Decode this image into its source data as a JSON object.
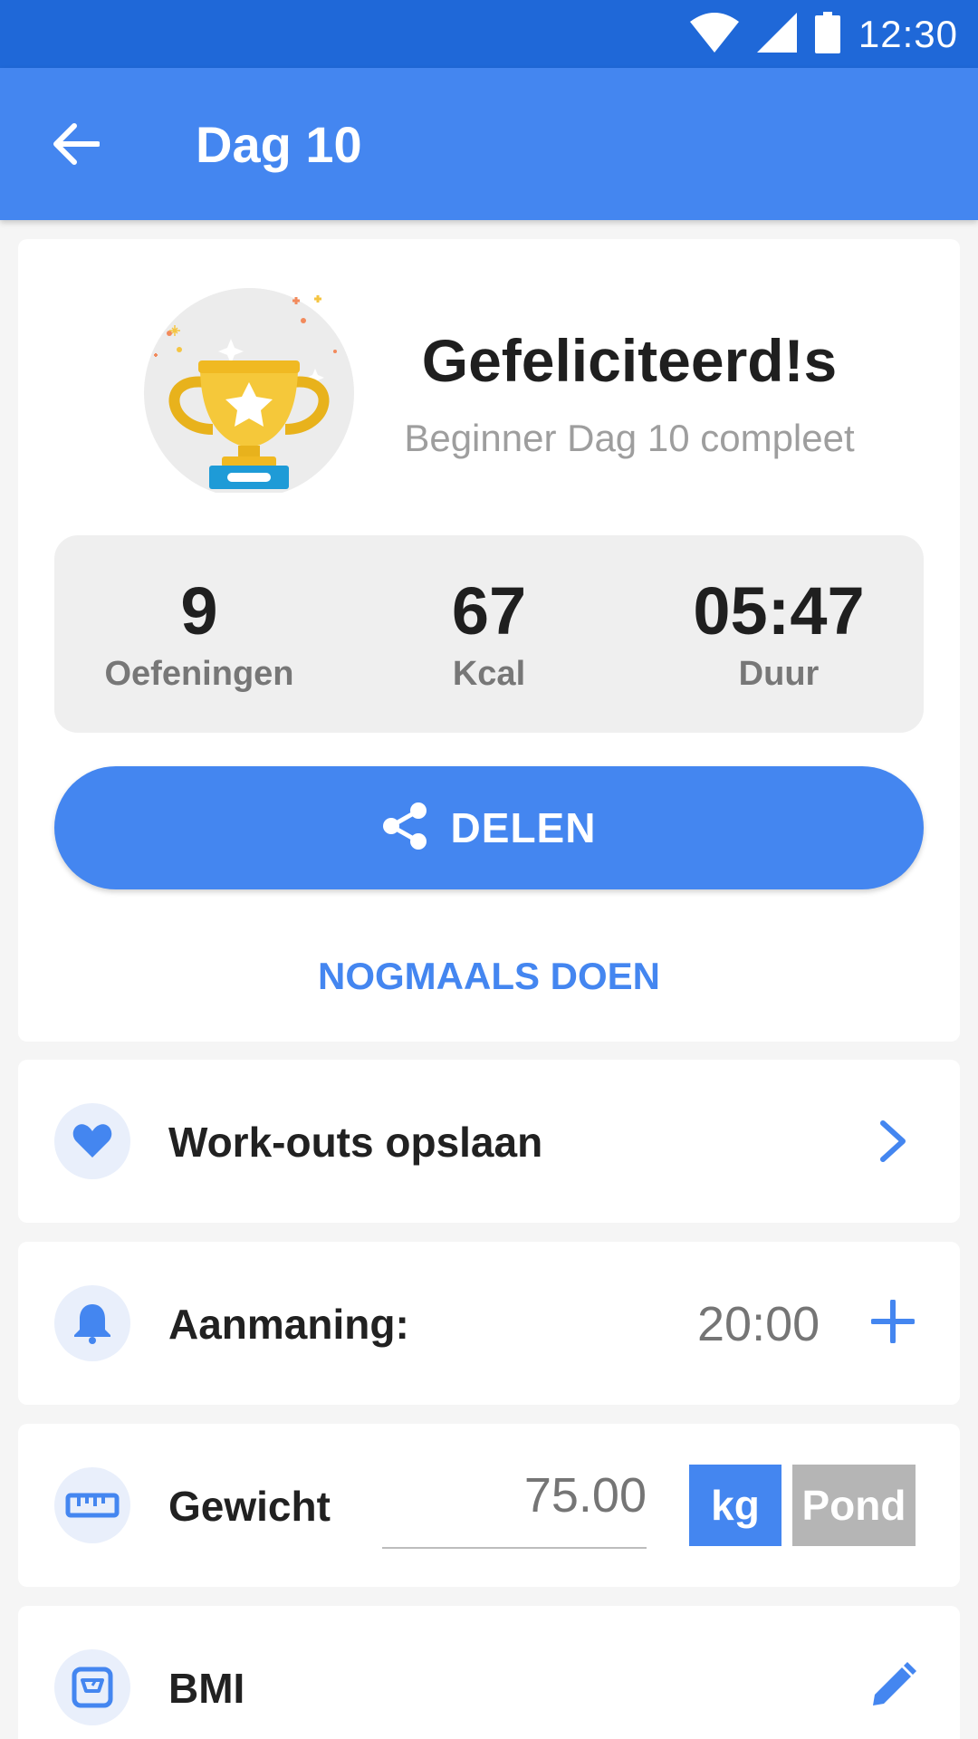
{
  "status_bar": {
    "time": "12:30"
  },
  "app_bar": {
    "title": "Dag 10"
  },
  "result": {
    "title": "Gefeliciteerd!s",
    "subtitle": "Beginner Dag 10 compleet"
  },
  "stats": [
    {
      "value": "9",
      "label": "Oefeningen"
    },
    {
      "value": "67",
      "label": "Kcal"
    },
    {
      "value": "05:47",
      "label": "Duur"
    }
  ],
  "share_button": {
    "label": "DELEN"
  },
  "redo_button": {
    "label": "NOGMAALS DOEN"
  },
  "save_workouts": {
    "label": "Work-outs opslaan"
  },
  "reminder": {
    "label": "Aanmaning:",
    "time": "20:00"
  },
  "weight": {
    "label": "Gewicht",
    "value": "75.00",
    "unit_kg": "kg",
    "unit_lb": "Pond",
    "selected_unit": "kg"
  },
  "bmi": {
    "label": "BMI"
  },
  "colors": {
    "primary": "#4486f0",
    "status_bar": "#1f68d8",
    "inactive_unit": "#b5b5b5"
  }
}
